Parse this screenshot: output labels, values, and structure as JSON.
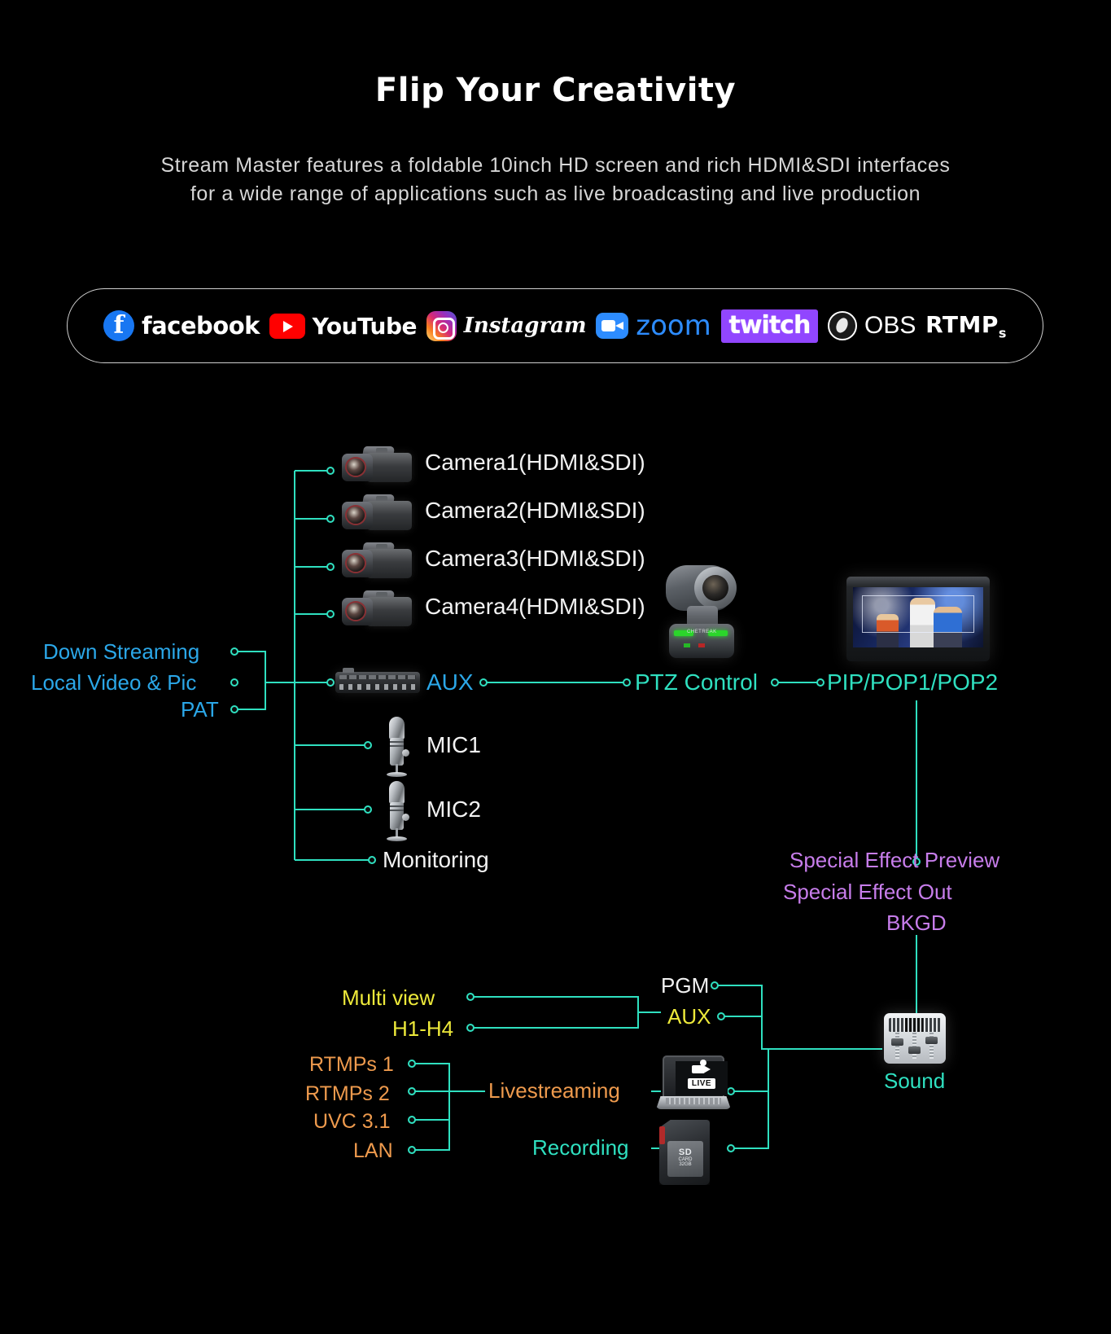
{
  "header": {
    "title": "Flip Your Creativity",
    "subtitle_line1": "Stream Master features a foldable 10inch HD screen and rich HDMI&SDI interfaces",
    "subtitle_line2": "for a wide range of applications such as live broadcasting and live production"
  },
  "platforms": [
    {
      "id": "facebook",
      "label": "facebook",
      "color": "#1877F2"
    },
    {
      "id": "youtube",
      "label": "YouTube",
      "color": "#FF0000"
    },
    {
      "id": "instagram",
      "label": "Instagram",
      "color": "#D62976"
    },
    {
      "id": "zoom",
      "label": "zoom",
      "color": "#2D8CFF"
    },
    {
      "id": "twitch",
      "label": "twitch",
      "color": "#9146FF"
    },
    {
      "id": "obs",
      "label": "OBS",
      "color": "#FFFFFF"
    },
    {
      "id": "rtmps",
      "label": "RTMP",
      "sub": "s",
      "color": "#FFFFFF"
    }
  ],
  "colors": {
    "wire": "#2FE0C0",
    "white": "#F2F2F2",
    "blue": "#2BA7E8",
    "teal": "#2FE0C0",
    "purple": "#C77DEB",
    "yellow": "#EDE93A",
    "orange": "#EE9A4D",
    "background": "#000000"
  },
  "diagram": {
    "inputs": {
      "cameras": [
        "Camera1(HDMI&SDI)",
        "Camera2(HDMI&SDI)",
        "Camera3(HDMI&SDI)",
        "Camera4(HDMI&SDI)"
      ],
      "left_sources": [
        "Down Streaming",
        "Local Video & Pic",
        "PAT"
      ],
      "aux": "AUX",
      "mics": [
        "MIC1",
        "MIC2"
      ],
      "monitoring": "Monitoring"
    },
    "ptz": {
      "control": "PTZ Control",
      "pip": "PIP/POP1/POP2"
    },
    "effects": [
      "Special Effect Preview",
      "Special Effect Out",
      "BKGD"
    ],
    "outputs": {
      "multi_view": "Multi view",
      "h_range": "H1-H4",
      "pgm": "PGM",
      "aux_out": "AUX",
      "sound": "Sound"
    },
    "streaming": {
      "protocols": [
        "RTMPs 1",
        "RTMPs 2",
        "UVC 3.1",
        "LAN"
      ],
      "livestreaming": "Livestreaming",
      "recording": "Recording"
    },
    "sd_card": {
      "label": "SD",
      "sub": "CARD",
      "capacity": "32GB"
    },
    "laptop_badge": "LIVE"
  }
}
